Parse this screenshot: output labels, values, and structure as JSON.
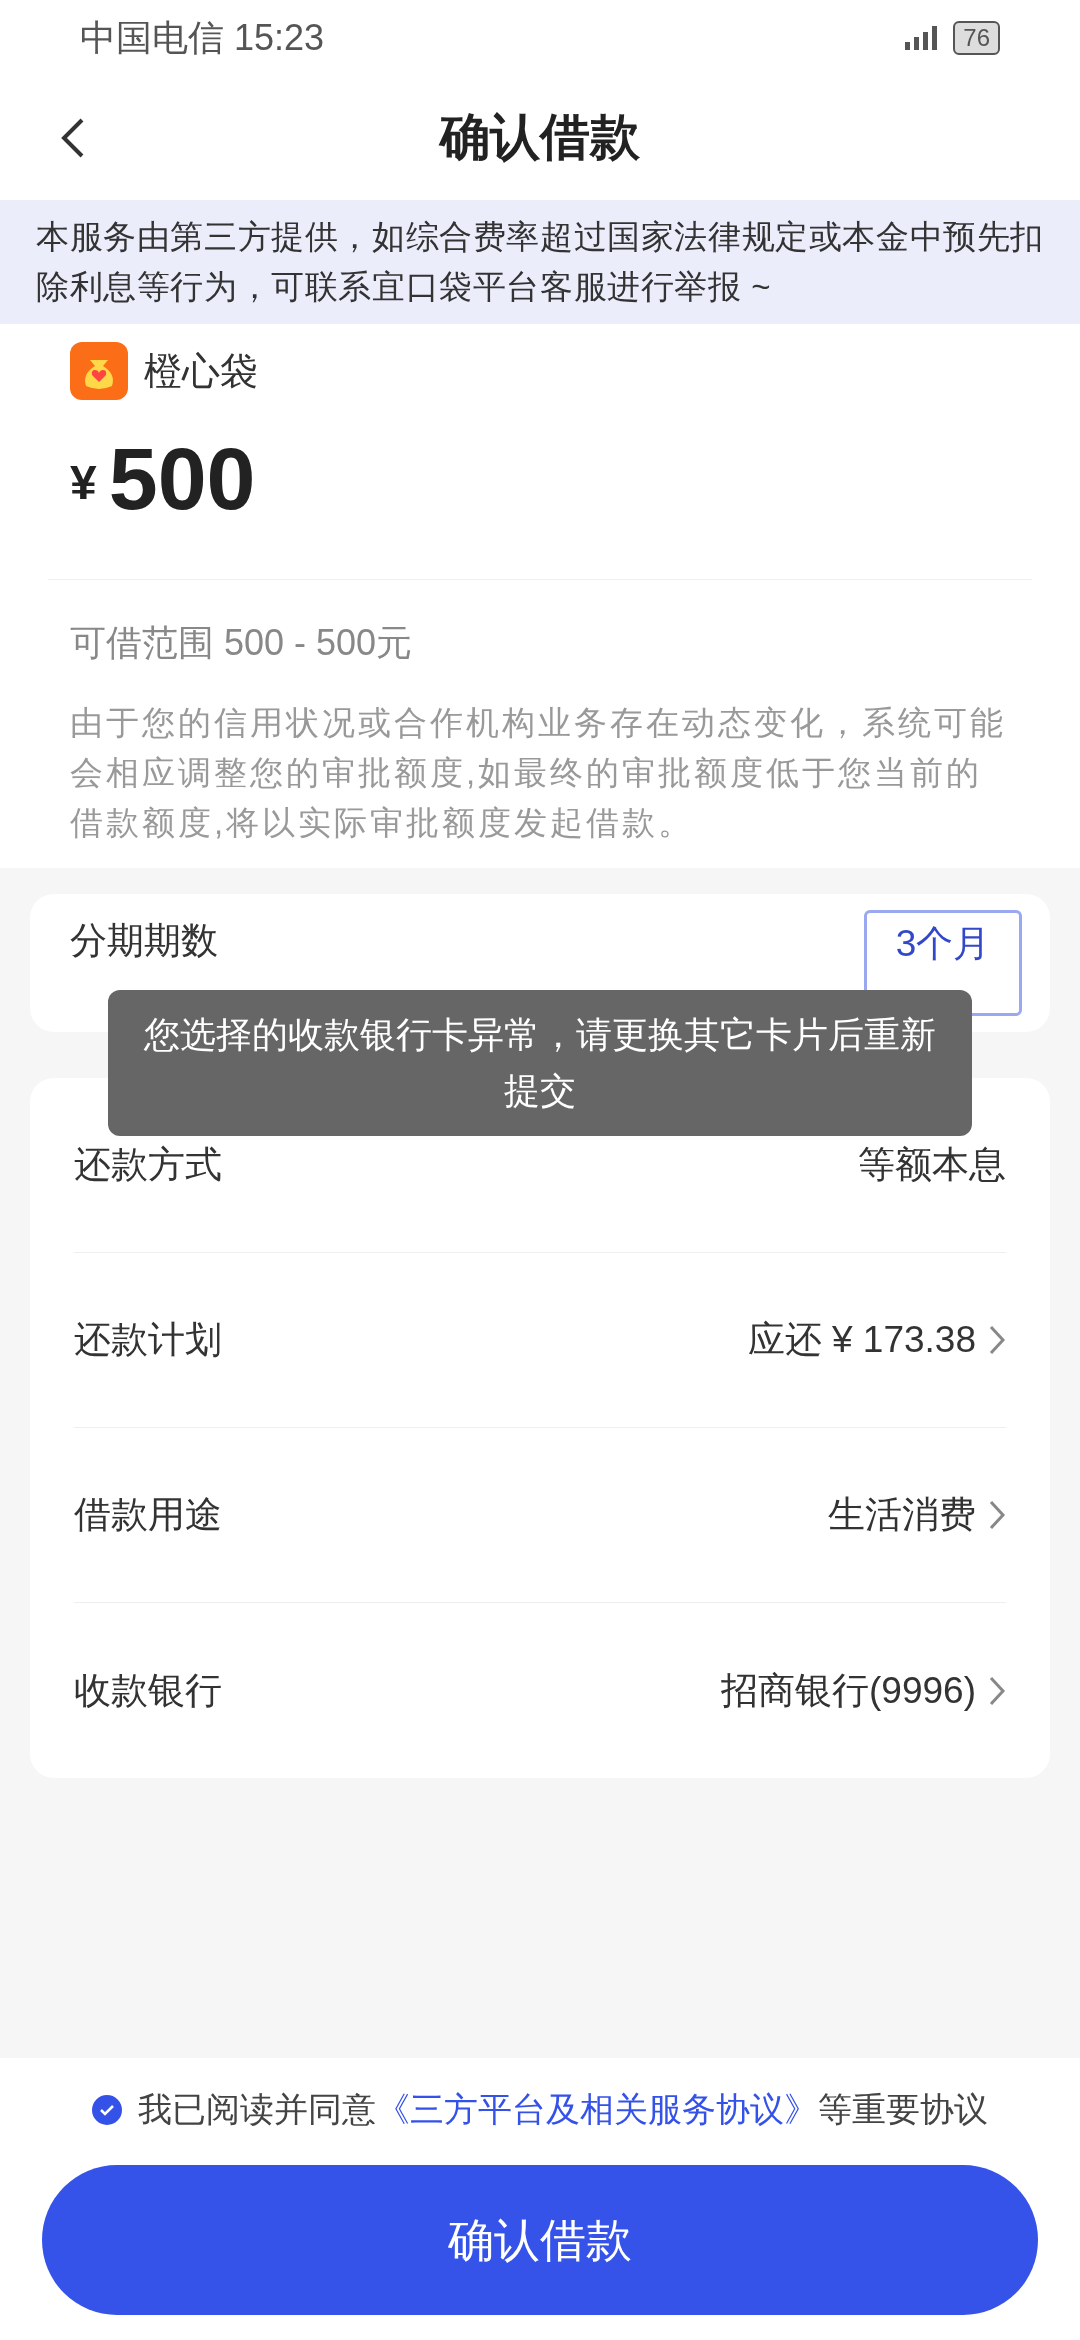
{
  "status_bar": {
    "carrier": "中国电信",
    "time": "15:23",
    "battery": "76"
  },
  "header": {
    "title": "确认借款"
  },
  "notice": "本服务由第三方提供，如综合费率超过国家法律规定或本金中预先扣除利息等行为，可联系宜口袋平台客服进行举报 ~",
  "loan": {
    "provider": "橙心袋",
    "currency": "¥",
    "amount": "500",
    "range": "可借范围 500 - 500元",
    "disclaimer": "由于您的信用状况或合作机构业务存在动态变化，系统可能会相应调整您的审批额度,如最终的审批额度低于您当前的借款额度,将以实际审批额度发起借款。"
  },
  "installments": {
    "label": "分期期数",
    "options": [
      {
        "label": "3个月",
        "selected": true
      }
    ]
  },
  "details": [
    {
      "kind": "plain",
      "label": "还款方式",
      "value": "等额本息"
    },
    {
      "kind": "link",
      "label": "还款计划",
      "value": "应还 ¥ 173.38"
    },
    {
      "kind": "link",
      "label": "借款用途",
      "value": "生活消费"
    },
    {
      "kind": "link",
      "label": "收款银行",
      "value": "招商银行(9996)"
    }
  ],
  "toast": "您选择的收款银行卡异常，请更换其它卡片后重新提交",
  "agreement": {
    "checked": true,
    "prefix": "我已阅读并同意",
    "link": "《三方平台及相关服务协议》",
    "suffix": "等重要协议"
  },
  "submit_button": "确认借款"
}
